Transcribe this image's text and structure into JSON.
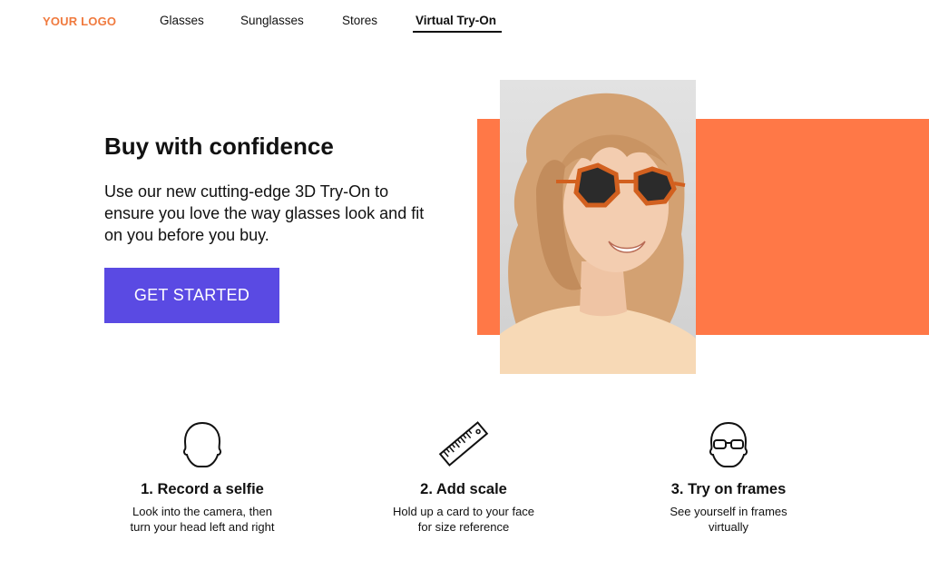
{
  "header": {
    "logo": "YOUR LOGO",
    "nav": [
      {
        "label": "Glasses"
      },
      {
        "label": "Sunglasses"
      },
      {
        "label": "Stores"
      },
      {
        "label": "Virtual Try-On"
      }
    ],
    "active_index": 3
  },
  "hero": {
    "title": "Buy with confidence",
    "text": "Use our new cutting-edge 3D Try-On to ensure you love the way glasses look and fit on you before you buy.",
    "cta_label": "GET STARTED",
    "accent_color": "#ff7847",
    "cta_color": "#5a4ae3"
  },
  "steps": [
    {
      "icon": "head-icon",
      "title": "1. Record a selfie",
      "desc": "Look into the camera, then\nturn your head left and right"
    },
    {
      "icon": "ruler-icon",
      "title": "2. Add scale",
      "desc": "Hold up a card to your face\nfor size reference"
    },
    {
      "icon": "head-glasses-icon",
      "title": "3. Try on frames",
      "desc": "See yourself in frames\nvirtually"
    }
  ]
}
